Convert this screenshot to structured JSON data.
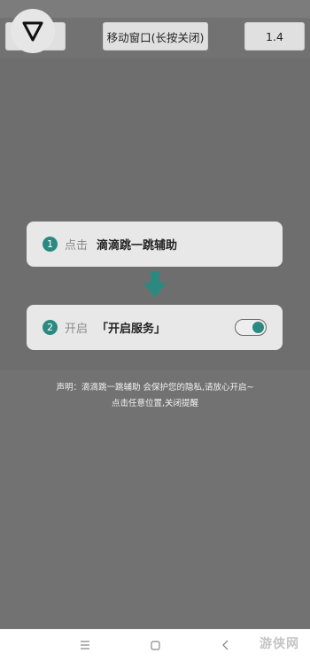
{
  "header": {
    "logo_icon": "triangle-down-icon",
    "left_button_label": "",
    "move_window_label": "移动窗口(长按关闭)",
    "version_label": "1.4"
  },
  "steps": [
    {
      "number": "1",
      "verb": "点击",
      "action": "滴滴跳一跳辅助"
    },
    {
      "number": "2",
      "verb": "开启",
      "action": "「开启服务」",
      "toggle_on": true
    }
  ],
  "arrow_icon": "arrow-down-icon",
  "notice": {
    "line1": "声明：滴滴跳一跳辅助 会保护您的隐私,请放心开启~",
    "line2": "点击任意位置,关闭提醒"
  },
  "nav": {
    "menu_icon": "menu-icon",
    "home_icon": "home-icon",
    "back_icon": "back-icon"
  },
  "watermark": "游侠网",
  "colors": {
    "accent": "#2a8a80",
    "overlay": "#6e6e6e"
  }
}
